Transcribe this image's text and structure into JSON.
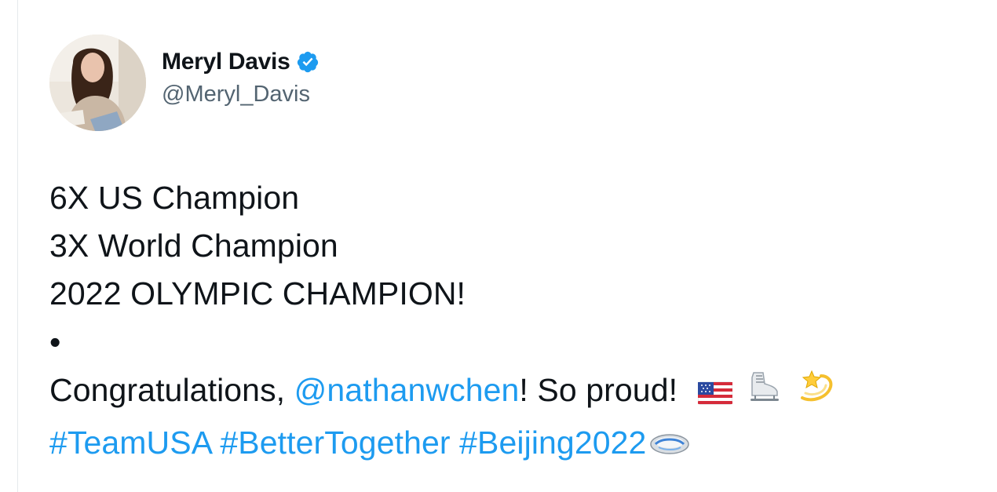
{
  "user": {
    "display_name": "Meryl Davis",
    "handle": "@Meryl_Davis",
    "verified": true,
    "verified_icon": "verified-badge-icon",
    "avatar_icon": "profile-photo"
  },
  "tweet": {
    "line1": "6X US Champion",
    "line2": "3X World Champion",
    "line3": "2022 OLYMPIC CHAMPION!",
    "line4": "•",
    "line5_prefix": "Congratulations, ",
    "mention": "@nathanwchen",
    "line5_suffix": "! So proud!",
    "hashtags": [
      "#TeamUSA",
      "#BetterTogether",
      "#Beijing2022"
    ],
    "emojis": [
      "us-flag-icon",
      "ice-skate-icon",
      "dizzy-star-icon",
      "beijing-2022-icon"
    ]
  },
  "colors": {
    "link": "#1d9bf0",
    "text": "#0f1419",
    "secondary": "#536471"
  }
}
